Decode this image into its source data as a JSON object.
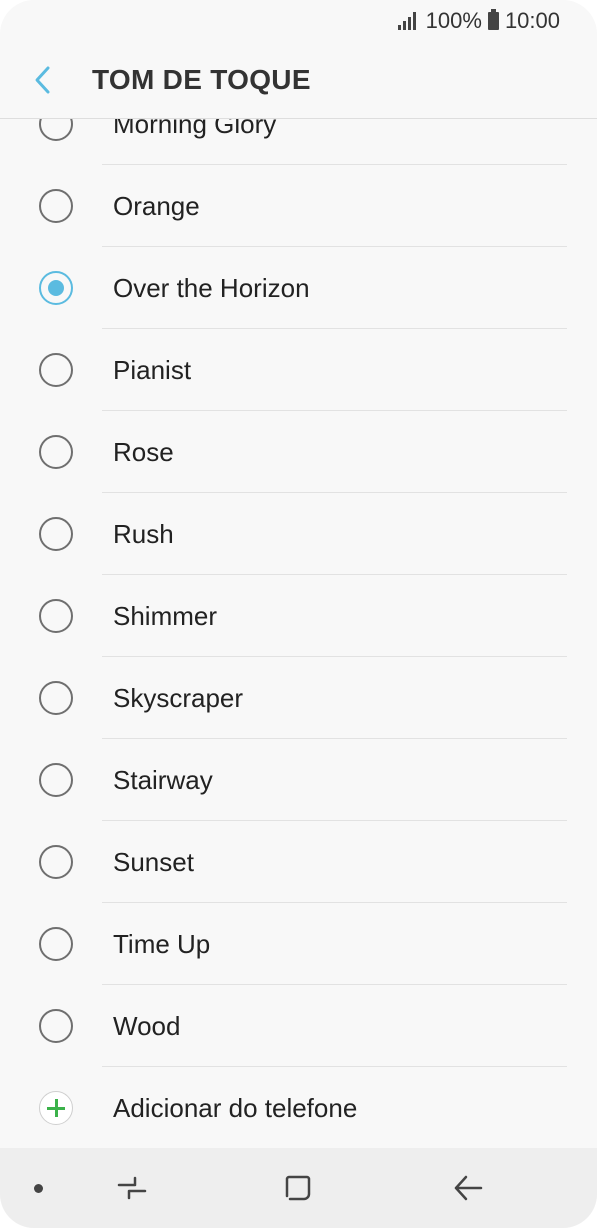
{
  "status_bar": {
    "battery": "100%",
    "time": "10:00"
  },
  "header": {
    "title": "TOM DE TOQUE"
  },
  "ringtones": [
    {
      "label": "Morning Glory",
      "selected": false
    },
    {
      "label": "Orange",
      "selected": false
    },
    {
      "label": "Over the Horizon",
      "selected": true
    },
    {
      "label": "Pianist",
      "selected": false
    },
    {
      "label": "Rose",
      "selected": false
    },
    {
      "label": "Rush",
      "selected": false
    },
    {
      "label": "Shimmer",
      "selected": false
    },
    {
      "label": "Skyscraper",
      "selected": false
    },
    {
      "label": "Stairway",
      "selected": false
    },
    {
      "label": "Sunset",
      "selected": false
    },
    {
      "label": "Time Up",
      "selected": false
    },
    {
      "label": "Wood",
      "selected": false
    }
  ],
  "add_from_phone": {
    "label": "Adicionar do telefone"
  },
  "colors": {
    "accent": "#5bbbe0",
    "add_icon": "#3bb24a"
  },
  "icons": {
    "back": "chevron-left-icon",
    "signal": "signal-icon",
    "battery": "battery-icon",
    "add": "plus-icon",
    "recent": "recent-apps-icon",
    "home": "home-icon",
    "nav_back": "back-arrow-icon"
  }
}
